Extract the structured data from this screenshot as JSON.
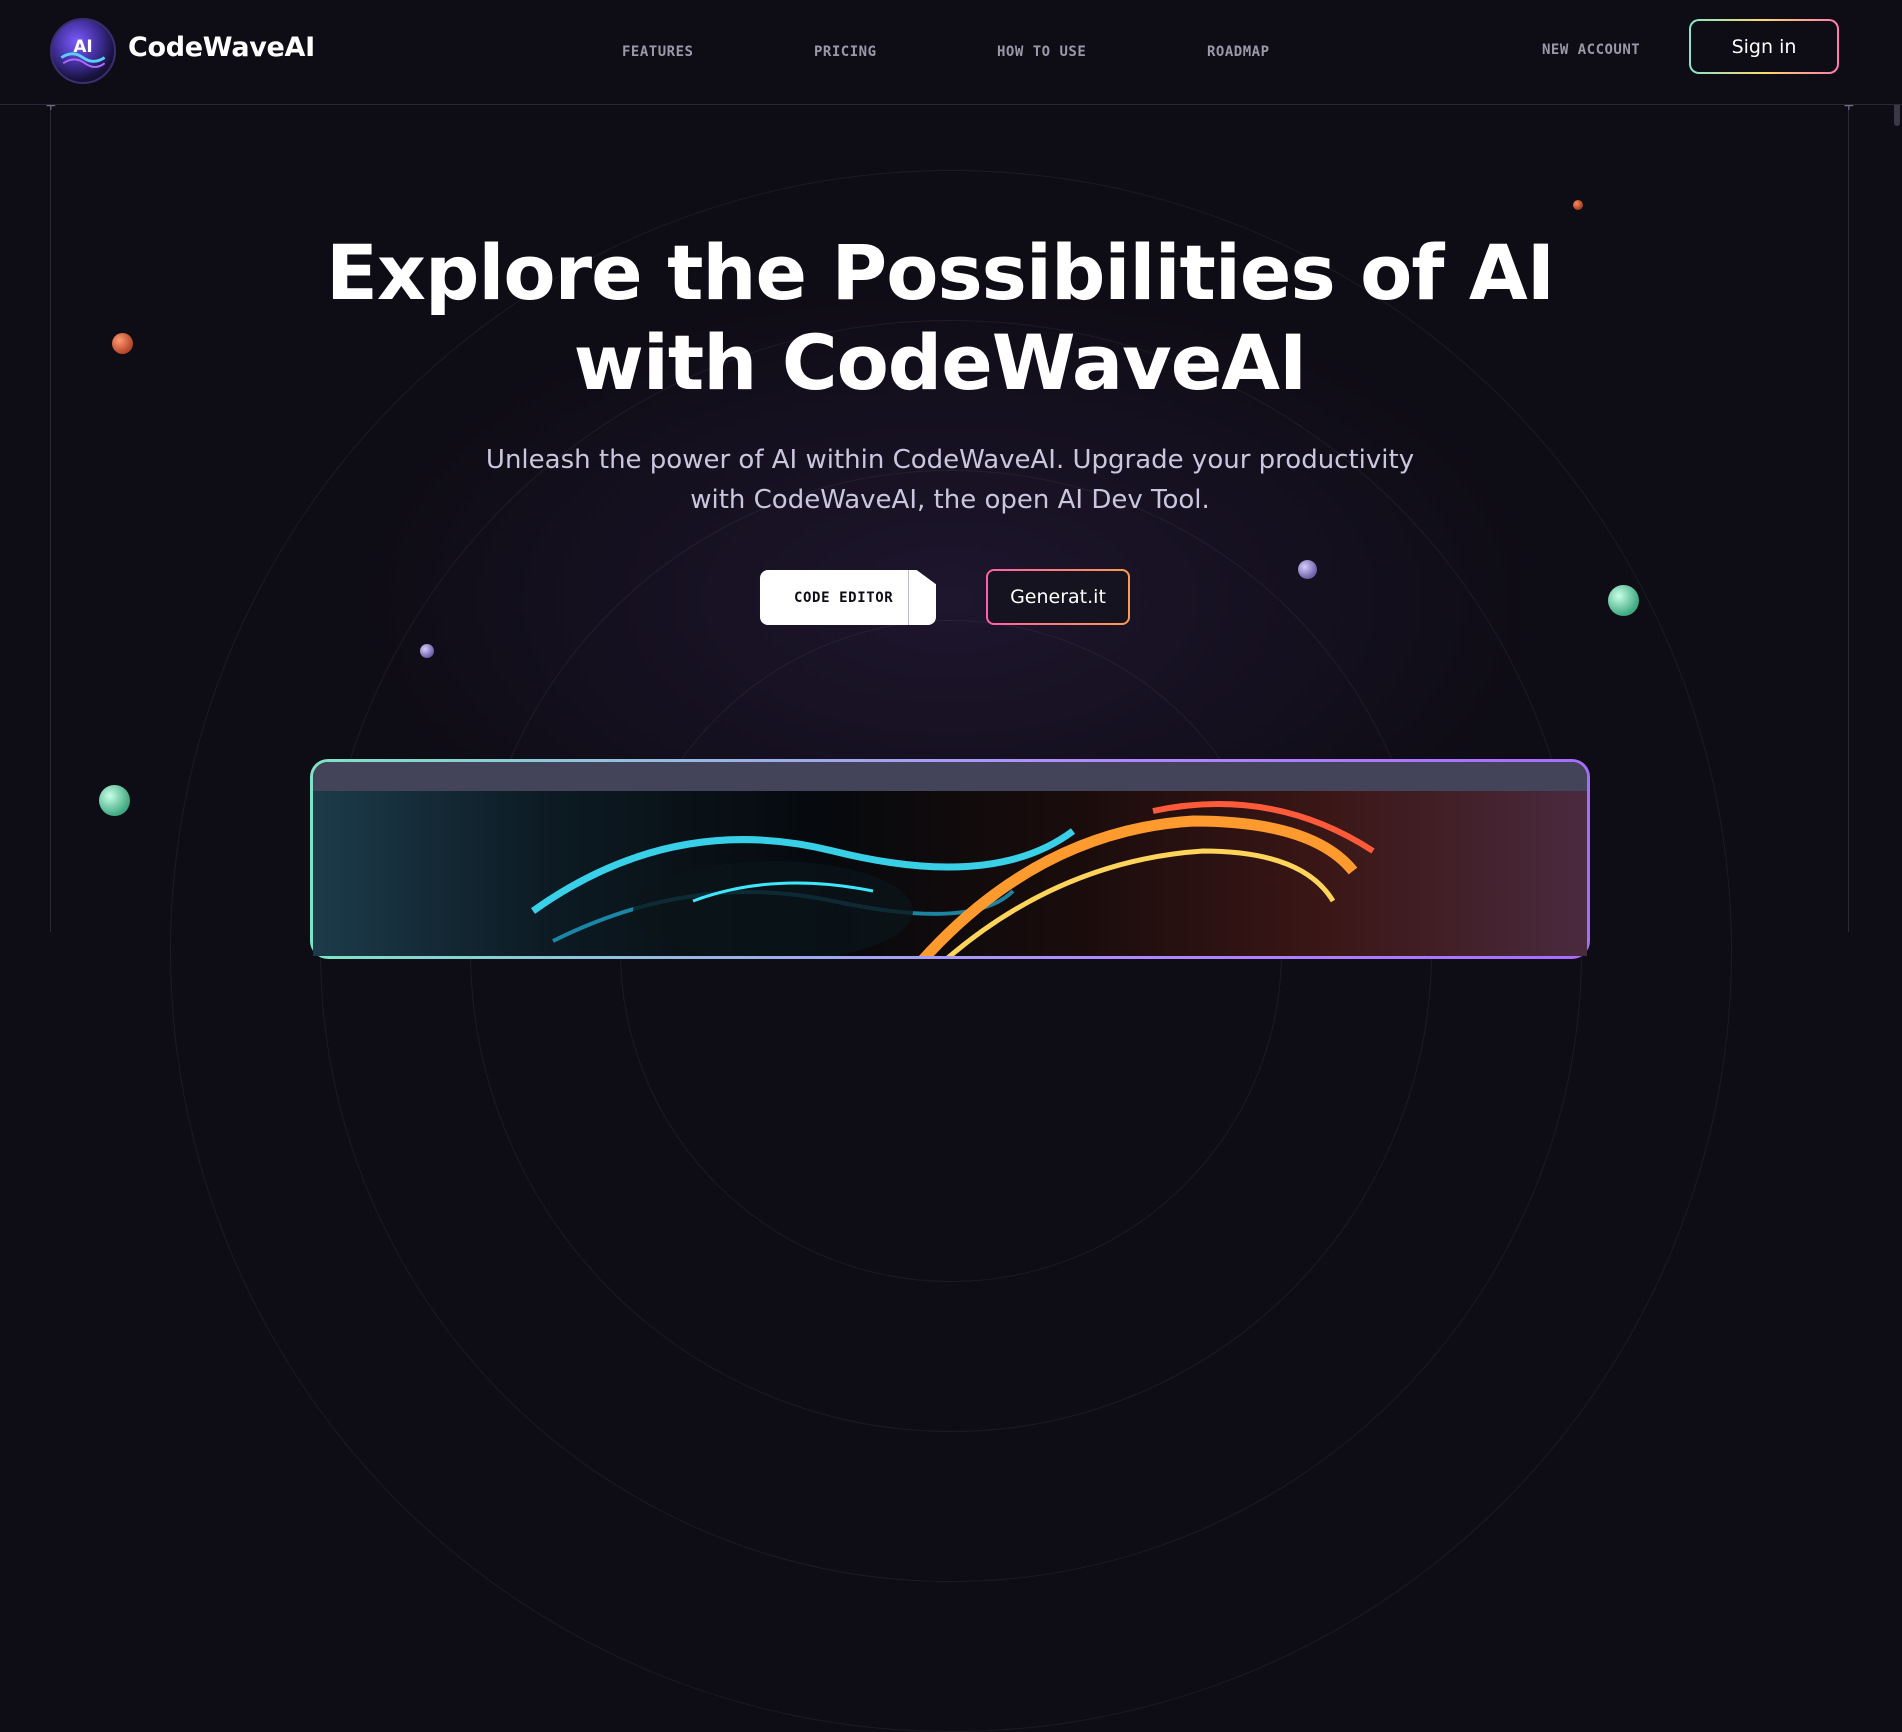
{
  "header": {
    "brand": "CodeWaveAI",
    "logo_text": "AI",
    "nav": [
      "FEATURES",
      "PRICING",
      "HOW TO USE",
      "ROADMAP"
    ],
    "new_account": "NEW ACCOUNT",
    "sign_in": "Sign in"
  },
  "hero": {
    "title_line1": "Explore the Possibilities of AI",
    "title_line2": "with CodeWaveAI",
    "subtitle_line1": "Unleash the power of AI within CodeWaveAI. Upgrade your productivity",
    "subtitle_line2": "with CodeWaveAI, the open AI Dev Tool.",
    "primary_button": "CODE EDITOR",
    "secondary_button": "Generat.it"
  },
  "colors": {
    "background": "#0e0c15",
    "sign_in_border": [
      "#86e6c9",
      "#ffd86e",
      "#ff7ab0"
    ],
    "generate_border": [
      "#ff5fa8",
      "#ff9b4f"
    ],
    "preview_border": [
      "#7ee3c6",
      "#b08cff",
      "#a86bff"
    ]
  },
  "icons": {
    "logo": "ai-logo-icon",
    "frame_corner": "plus-icon"
  }
}
